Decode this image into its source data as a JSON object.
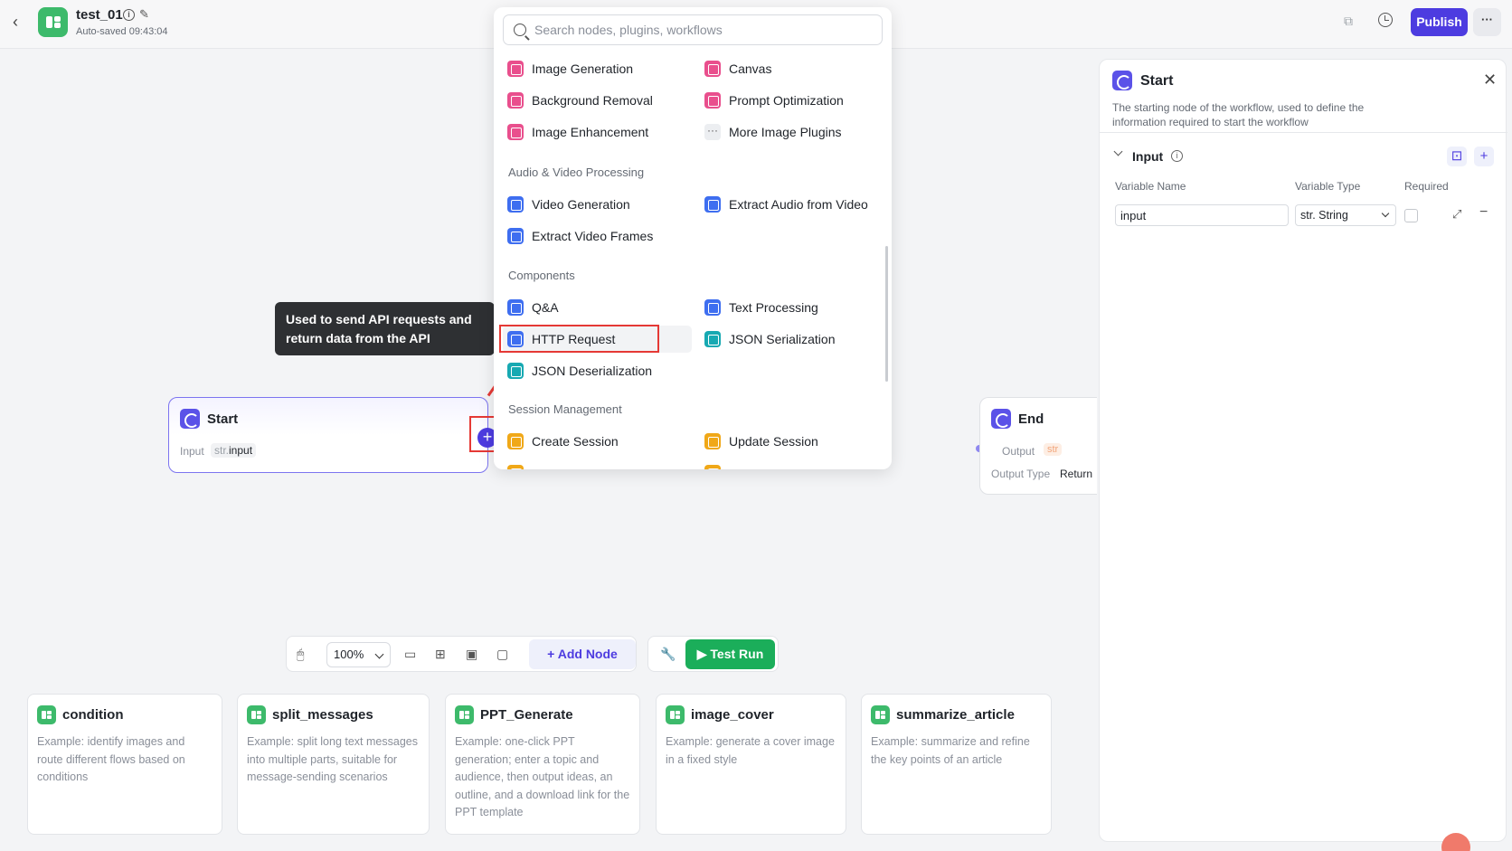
{
  "header": {
    "workflow_name": "test_01",
    "autosave": "Auto-saved 09:43:04",
    "publish_label": "Publish",
    "more_label": "···",
    "info_glyph": "i",
    "edit_glyph": "✎",
    "back_glyph": "‹",
    "copy_glyph": "⧉"
  },
  "picker": {
    "search_placeholder": "Search nodes, plugins, workflows",
    "image_items": [
      {
        "label": "Image Generation",
        "icon": "image-generation-icon"
      },
      {
        "label": "Canvas",
        "icon": "canvas-icon"
      },
      {
        "label": "Background Removal",
        "icon": "background-removal-icon"
      },
      {
        "label": "Prompt Optimization",
        "icon": "prompt-optimization-icon"
      },
      {
        "label": "Image Enhancement",
        "icon": "image-enhancement-icon"
      },
      {
        "label": "More Image Plugins",
        "icon": "more-icon"
      }
    ],
    "av_section": "Audio & Video Processing",
    "av_items": [
      {
        "label": "Video Generation",
        "icon": "video-generation-icon"
      },
      {
        "label": "Extract Audio from Video",
        "icon": "extract-audio-icon"
      },
      {
        "label": "Extract Video Frames",
        "icon": "extract-frames-icon"
      }
    ],
    "components_section": "Components",
    "component_items": [
      {
        "label": "Q&A",
        "icon": "qa-icon"
      },
      {
        "label": "Text Processing",
        "icon": "text-processing-icon"
      },
      {
        "label": "HTTP Request",
        "icon": "http-request-icon"
      },
      {
        "label": "JSON Serialization",
        "icon": "json-serialization-icon"
      },
      {
        "label": "JSON Deserialization",
        "icon": "json-deserialization-icon"
      }
    ],
    "session_section": "Session Management",
    "session_items": [
      {
        "label": "Create Session",
        "icon": "create-session-icon"
      },
      {
        "label": "Update Session",
        "icon": "update-session-icon"
      }
    ]
  },
  "tooltip": {
    "text": "Used to send API requests and return data from the API"
  },
  "start_node": {
    "title": "Start",
    "input_label": "Input",
    "chip_prefix": "str.",
    "chip_value": "input",
    "add_glyph": "+"
  },
  "end_node": {
    "title": "End",
    "output_label": "Output",
    "output_type_tag": "str",
    "output_type_label": "Output Type",
    "output_type_value": "Return"
  },
  "toolbar": {
    "zoom": "100%",
    "add_node_label": "+ Add Node",
    "test_run_label": "▶ Test Run"
  },
  "templates": [
    {
      "title": "condition",
      "desc": "Example: identify images and route different flows based on conditions"
    },
    {
      "title": "split_messages",
      "desc": "Example: split long text messages into multiple parts, suitable for message-sending scenarios"
    },
    {
      "title": "PPT_Generate",
      "desc": "Example: one-click PPT generation; enter a topic and audience, then output ideas, an outline, and a download link for the PPT template"
    },
    {
      "title": "image_cover",
      "desc": "Example: generate a cover image in a fixed style"
    },
    {
      "title": "summarize_article",
      "desc": "Example: summarize and refine the key points of an article"
    }
  ],
  "properties": {
    "title": "Start",
    "description": "The starting node of the workflow, used to define the information required to start the workflow",
    "close_glyph": "✕",
    "section": "Input",
    "col_name": "Variable Name",
    "col_type": "Variable Type",
    "col_required": "Required",
    "row": {
      "name": "input",
      "type": "str. String"
    }
  },
  "colors": {
    "accent": "#4d3ce0",
    "green": "#1bae5a",
    "highlight_red": "#e53935"
  }
}
